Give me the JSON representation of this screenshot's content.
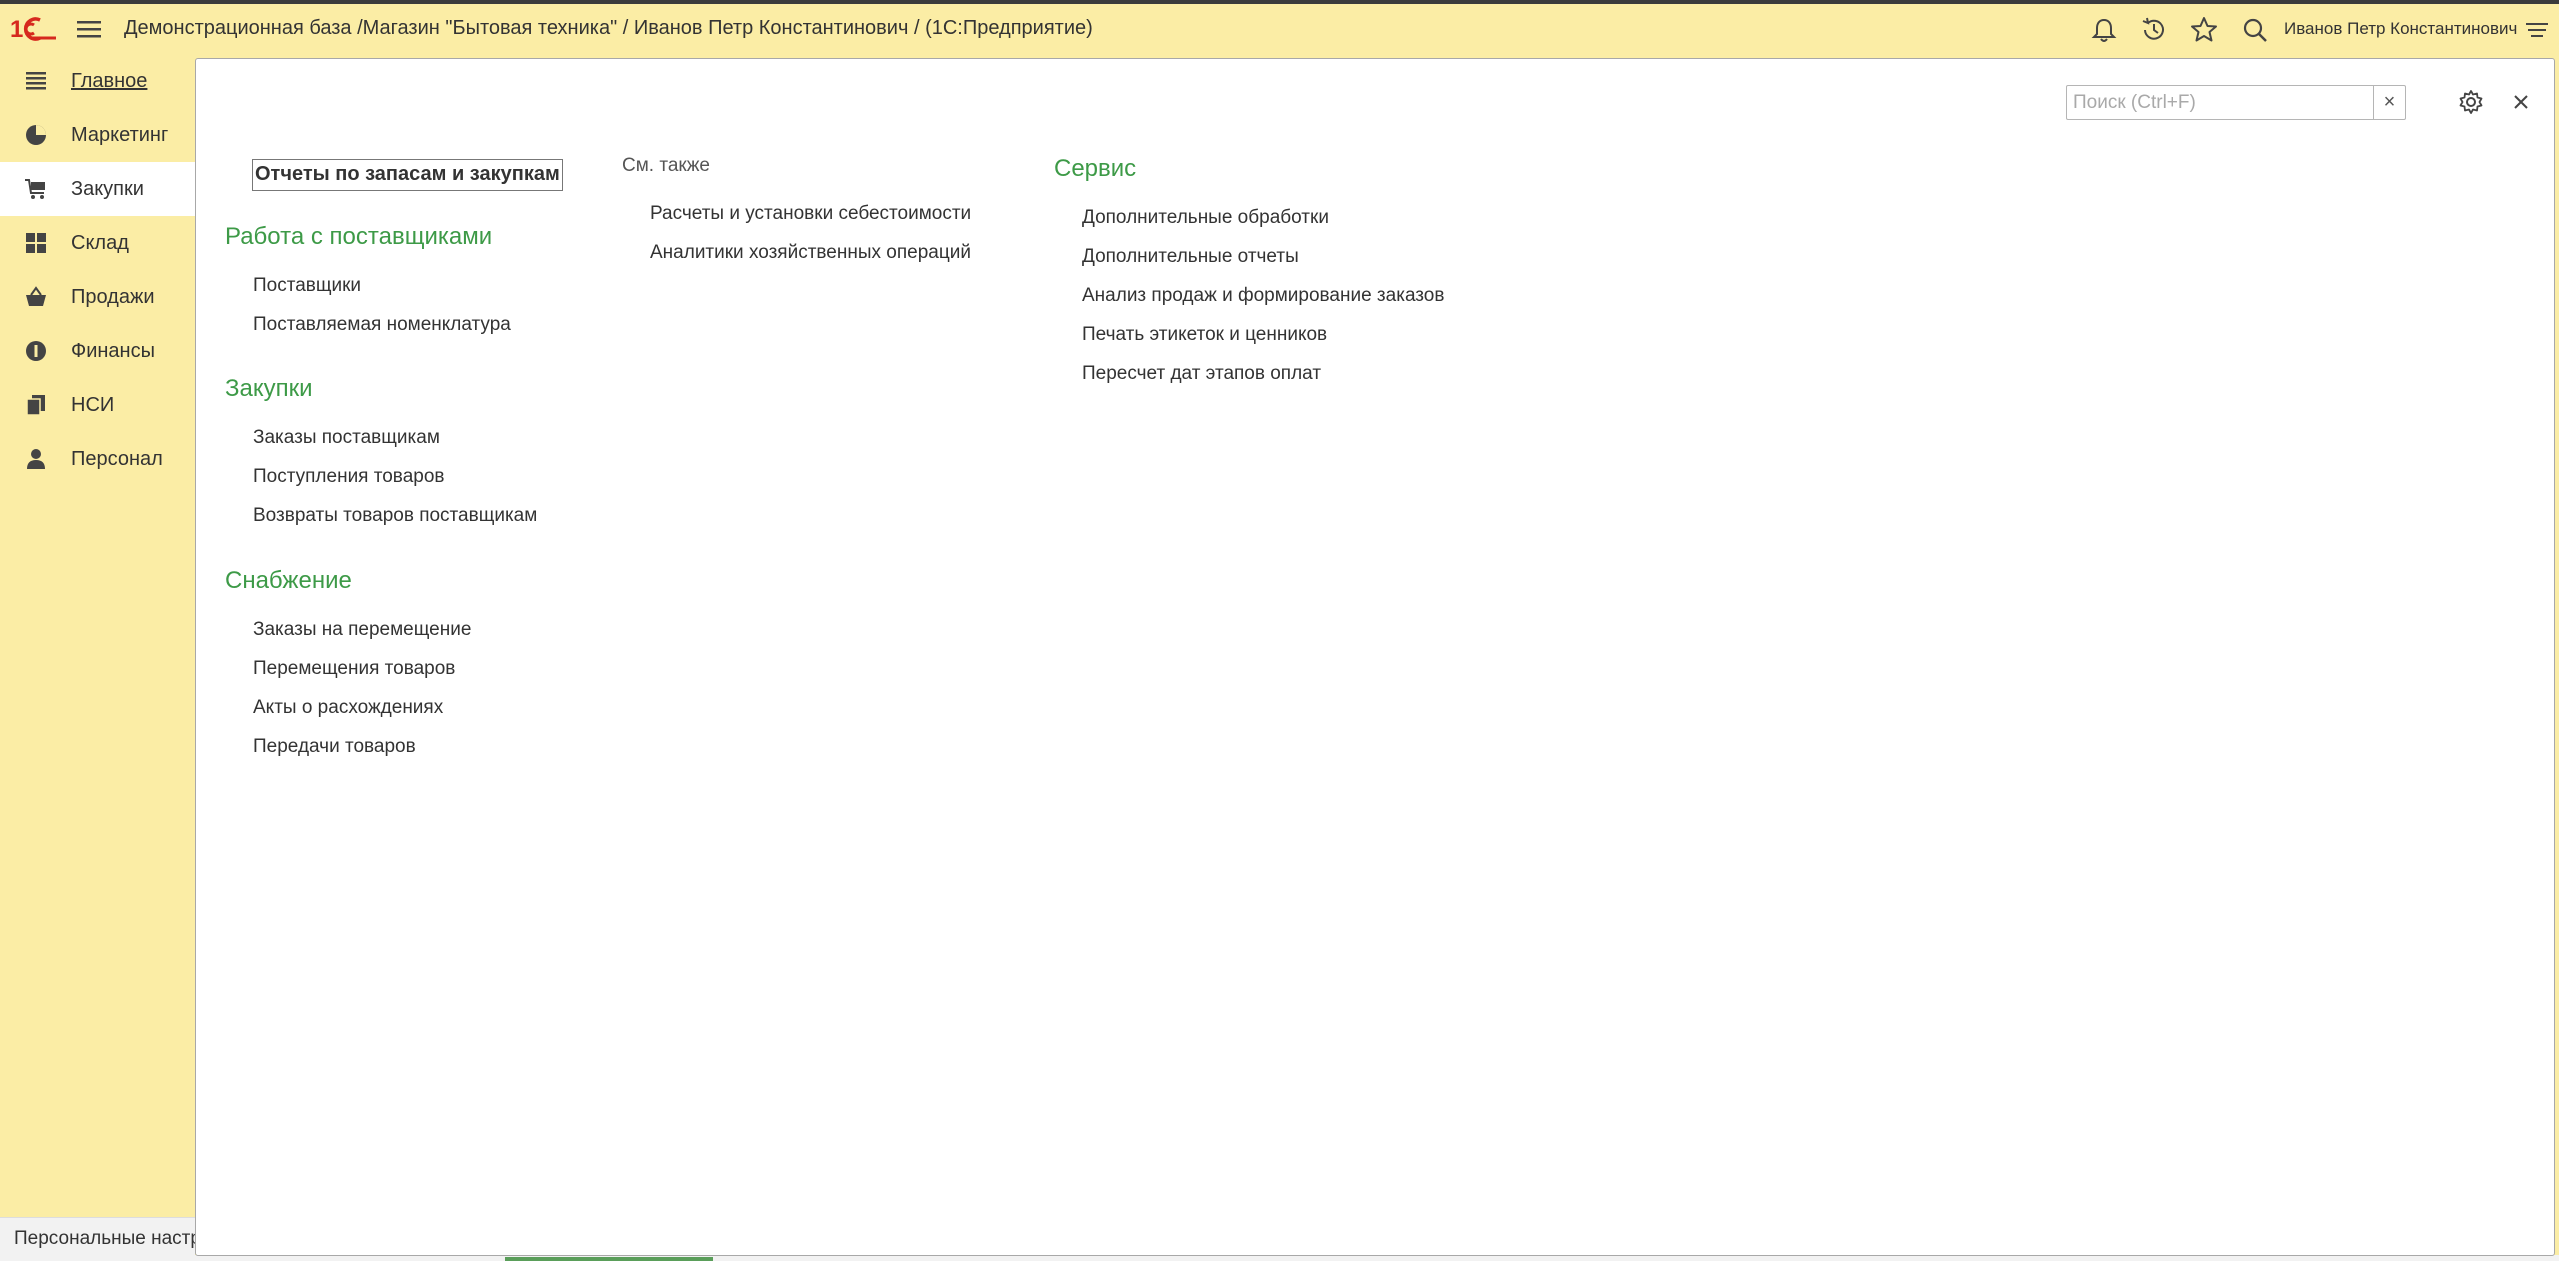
{
  "app": {
    "title": "Демонстрационная база /Магазин \"Бытовая техника\" / Иванов Петр Константинович /  (1С:Предприятие)",
    "user": "Иванов Петр Константинович",
    "icons": [
      "logo-1c-icon",
      "menu-icon",
      "bell-icon",
      "history-icon",
      "star-icon",
      "search-icon",
      "settings-lines-icon"
    ]
  },
  "sidebar": {
    "items": [
      {
        "label": "Главное",
        "icon": "list-icon"
      },
      {
        "label": "Маркетинг",
        "icon": "pie-chart-icon"
      },
      {
        "label": "Закупки",
        "icon": "cart-icon"
      },
      {
        "label": "Склад",
        "icon": "grid-icon"
      },
      {
        "label": "Продажи",
        "icon": "basket-icon"
      },
      {
        "label": "Финансы",
        "icon": "coin-icon"
      },
      {
        "label": "НСИ",
        "icon": "documents-icon"
      },
      {
        "label": "Персонал",
        "icon": "person-icon"
      }
    ],
    "active": "Закупки",
    "bottom_text": "Персональные настройки"
  },
  "panel": {
    "search_placeholder": "Поиск (Ctrl+F)",
    "search_value": "",
    "search_clear": "×",
    "report_link": "Отчеты по запасам и закупкам",
    "see_also_label": "См. также",
    "see_also_links": [
      "Расчеты и установки себестоимости",
      "Аналитики хозяйственных операций"
    ],
    "sections": [
      {
        "title": "Работа с поставщиками",
        "links": [
          "Поставщики",
          "Поставляемая номенклатура"
        ]
      },
      {
        "title": "Закупки",
        "links": [
          "Заказы поставщикам",
          "Поступления товаров",
          "Возвраты товаров поставщикам"
        ]
      },
      {
        "title": "Снабжение",
        "links": [
          "Заказы на перемещение",
          "Перемещения товаров",
          "Акты о расхождениях",
          "Передачи товаров"
        ]
      },
      {
        "title": "Сервис",
        "links": [
          "Дополнительные обработки",
          "Дополнительные отчеты",
          "Анализ продаж и формирование заказов",
          "Печать этикеток и ценников",
          "Пересчет дат этапов оплат"
        ]
      }
    ]
  },
  "colors": {
    "background": "#fbeda5",
    "section_heading": "#3d9a47",
    "panel": "#ffffff"
  }
}
